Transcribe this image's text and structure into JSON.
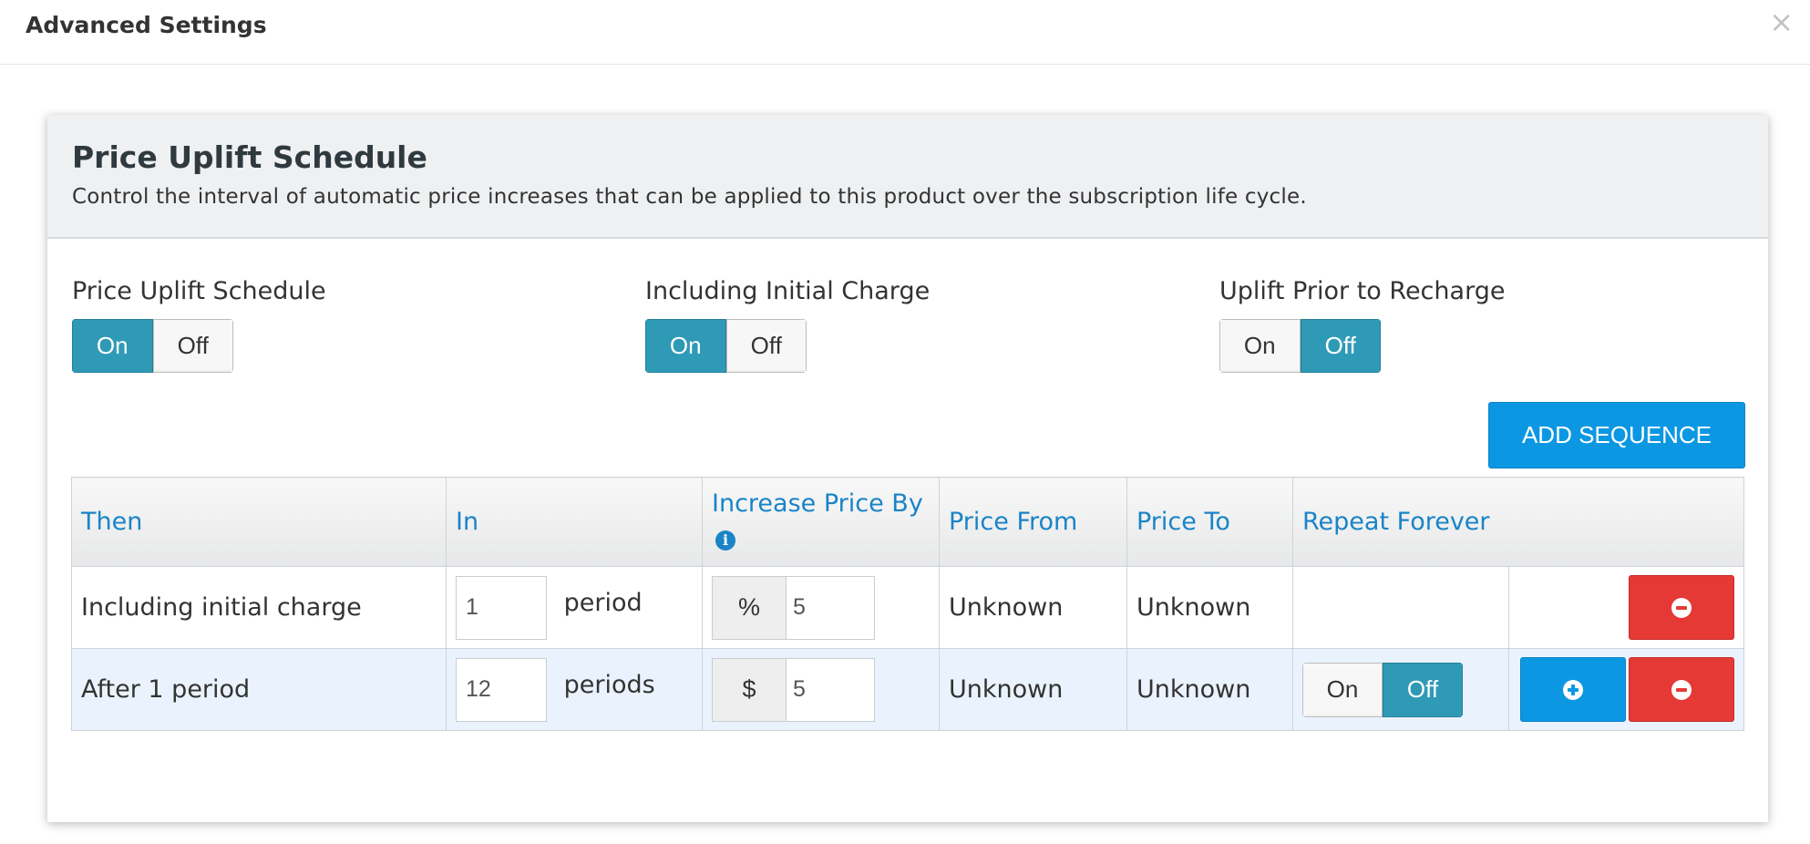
{
  "modal": {
    "title": "Advanced Settings",
    "close_symbol": "×"
  },
  "panel": {
    "title": "Price Uplift Schedule",
    "description": "Control the interval of automatic price increases that can be applied to this product over the subscription life cycle."
  },
  "toggles": [
    {
      "label": "Price Uplift Schedule",
      "on": "On",
      "off": "Off",
      "selected": "On"
    },
    {
      "label": "Including Initial Charge",
      "on": "On",
      "off": "Off",
      "selected": "On"
    },
    {
      "label": "Uplift Prior to Recharge",
      "on": "On",
      "off": "Off",
      "selected": "Off"
    }
  ],
  "add_sequence_label": "ADD SEQUENCE",
  "table": {
    "headers": {
      "then": "Then",
      "in": "In",
      "increase": "Increase Price By",
      "price_from": "Price From",
      "price_to": "Price To",
      "repeat": "Repeat Forever"
    },
    "rows": [
      {
        "then": "Including initial charge",
        "in_value": "1",
        "in_unit": "period",
        "addon": "%",
        "increase_value": "5",
        "price_from": "Unknown",
        "price_to": "Unknown"
      },
      {
        "then": "After 1 period",
        "in_value": "12",
        "in_unit": "periods",
        "addon": "$",
        "increase_value": "5",
        "price_from": "Unknown",
        "price_to": "Unknown",
        "repeat_on": "On",
        "repeat_off": "Off",
        "repeat_selected": "Off"
      }
    ]
  },
  "colors": {
    "accent": "#2f9ab6",
    "primary_button": "#0c97e3",
    "danger": "#e53935",
    "header_link": "#1a84c6"
  },
  "icons": {
    "close": "close-icon",
    "info": "info-icon",
    "plus": "plus-circle-icon",
    "minus": "minus-circle-icon"
  }
}
